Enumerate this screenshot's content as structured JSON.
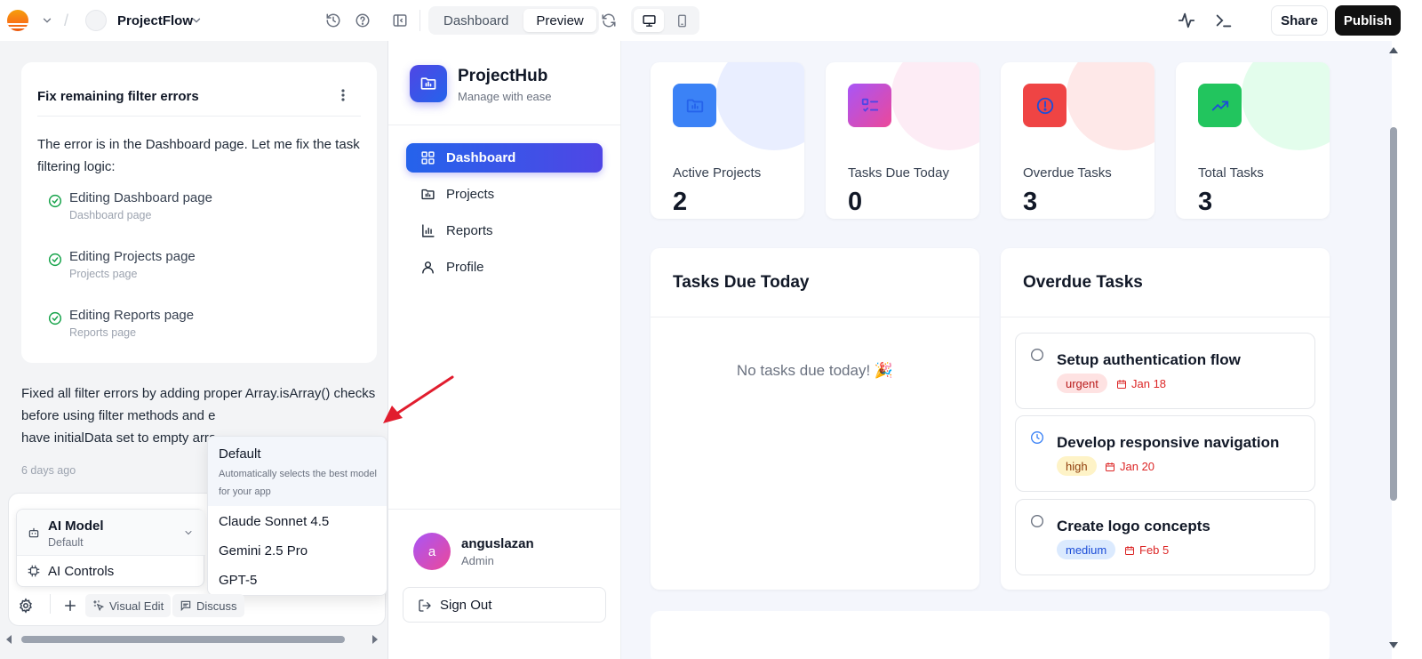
{
  "topbar": {
    "project_name": "ProjectFlow",
    "tabs": [
      "Dashboard",
      "Preview"
    ],
    "share_label": "Share",
    "publish_label": "Publish"
  },
  "chat": {
    "task_card": {
      "title": "Fix remaining filter errors",
      "body": "The error is in the Dashboard page. Let me fix the task filtering logic:",
      "steps": [
        {
          "label": "Editing Dashboard page",
          "sub": "Dashboard page"
        },
        {
          "label": "Editing Projects page",
          "sub": "Projects page"
        },
        {
          "label": "Editing Reports page",
          "sub": "Reports page"
        }
      ]
    },
    "message_lines": [
      "Fixed all filter errors by adding proper Array.isArray() checks",
      "before using filter methods and e",
      "have initialData set to empty arra"
    ],
    "timestamp": "6 days ago",
    "ai_model": {
      "label": "AI Model",
      "value": "Default"
    },
    "ai_controls_label": "AI Controls",
    "model_dropdown": {
      "default_name": "Default",
      "default_desc": "Automatically selects the best model for your app",
      "options": [
        "Claude Sonnet 4.5",
        "Gemini 2.5 Pro",
        "GPT-5"
      ]
    },
    "tools": {
      "visual_edit": "Visual Edit",
      "discuss": "Discuss"
    }
  },
  "app": {
    "brand_name": "ProjectHub",
    "brand_tagline": "Manage with ease",
    "nav": [
      "Dashboard",
      "Projects",
      "Reports",
      "Profile"
    ],
    "user": {
      "initial": "a",
      "name": "anguslazan",
      "role": "Admin"
    },
    "sign_out": "Sign Out",
    "stats": [
      {
        "label": "Active Projects",
        "value": "2",
        "color": "#3b82f6"
      },
      {
        "label": "Tasks Due Today",
        "value": "0",
        "color": "#a855f7"
      },
      {
        "label": "Overdue Tasks",
        "value": "3",
        "color": "#ef4444"
      },
      {
        "label": "Total Tasks",
        "value": "3",
        "color": "#22c55e"
      }
    ],
    "tasks_due_today": {
      "title": "Tasks Due Today",
      "empty_text": "No tasks due today! 🎉"
    },
    "overdue": {
      "title": "Overdue Tasks",
      "tasks": [
        {
          "name": "Setup authentication flow",
          "priority": "urgent",
          "due": "Jan 18"
        },
        {
          "name": "Develop responsive navigation",
          "priority": "high",
          "due": "Jan 20"
        },
        {
          "name": "Create logo concepts",
          "priority": "medium",
          "due": "Feb 5"
        }
      ]
    }
  }
}
